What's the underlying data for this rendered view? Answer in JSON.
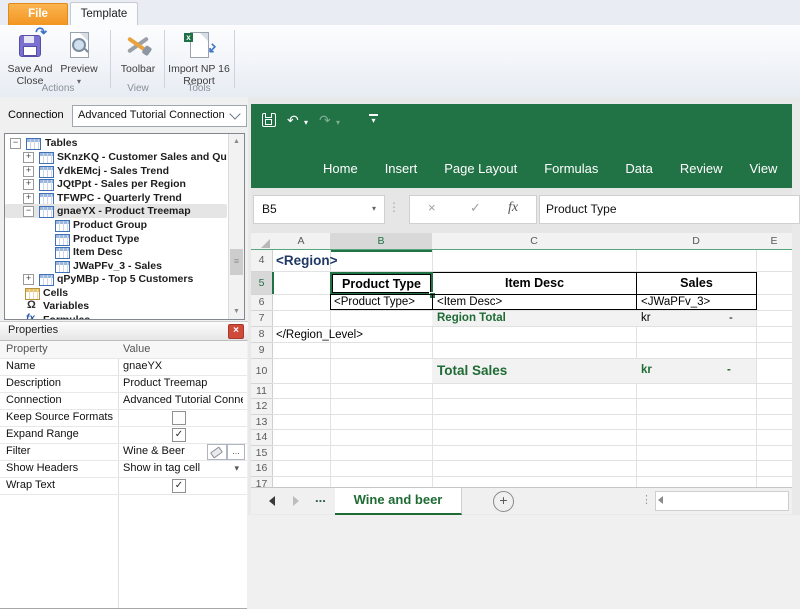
{
  "ribbon": {
    "tabs": [
      {
        "label": "File"
      },
      {
        "label": "Template"
      }
    ],
    "buttons": {
      "save_and_close": "Save And Close",
      "preview": "Preview",
      "toolbar": "Toolbar",
      "import_np": "Import NP 16 Report"
    },
    "groups": [
      {
        "label": "Actions"
      },
      {
        "label": "View"
      },
      {
        "label": "Tools"
      }
    ]
  },
  "connection": {
    "label": "Connection",
    "value": "Advanced Tutorial Connection"
  },
  "tree": {
    "items": [
      {
        "label": "Tables"
      },
      {
        "label": "SKnzKQ - Customer Sales and Quantity"
      },
      {
        "label": "YdkEMcj - Sales Trend"
      },
      {
        "label": "JQtPpt - Sales per Region"
      },
      {
        "label": "TFWPC - Quarterly Trend"
      },
      {
        "label": "gnaeYX - Product Treemap"
      },
      {
        "label": "Product Group"
      },
      {
        "label": "Product Type"
      },
      {
        "label": "Item Desc"
      },
      {
        "label": "JWaPFv_3 - Sales"
      },
      {
        "label": "qPyMBp - Top 5 Customers"
      },
      {
        "label": "Cells"
      },
      {
        "label": "Variables"
      },
      {
        "label": "Formulas"
      }
    ]
  },
  "properties": {
    "title": "Properties",
    "columns": {
      "property": "Property",
      "value": "Value"
    },
    "rows": [
      {
        "property": "Name",
        "value": "gnaeYX"
      },
      {
        "property": "Description",
        "value": "Product Treemap"
      },
      {
        "property": "Connection",
        "value": "Advanced Tutorial Connecti"
      },
      {
        "property": "Keep Source Formats",
        "value": ""
      },
      {
        "property": "Expand Range",
        "value": ""
      },
      {
        "property": "Filter",
        "value": "Wine & Beer"
      },
      {
        "property": "Show Headers",
        "value": "Show in tag cell"
      },
      {
        "property": "Wrap Text",
        "value": ""
      }
    ]
  },
  "excel": {
    "ribbon_tabs": [
      "Home",
      "Insert",
      "Page Layout",
      "Formulas",
      "Data",
      "Review",
      "View"
    ],
    "name_box": "B5",
    "formula_text": "Product Type",
    "columns": [
      "A",
      "B",
      "C",
      "D",
      "E"
    ],
    "row_numbers": [
      "4",
      "5",
      "6",
      "7",
      "8",
      "9",
      "10",
      "11",
      "12",
      "13",
      "14",
      "15",
      "16",
      "17"
    ],
    "cells": {
      "region_open": "<Region>",
      "product_type_header": "Product Type",
      "item_desc_header": "Item Desc",
      "sales_header": "Sales",
      "product_type_tag": "<Product Type>",
      "item_desc_tag": "<Item Desc>",
      "sales_tag": "<JWaPFv_3>",
      "region_total_label": "Region Total",
      "region_total_currency": "kr",
      "region_total_value": "-",
      "region_close": "</Region_Level>",
      "total_sales_label": "Total Sales",
      "total_sales_currency": "kr",
      "total_sales_value": "-"
    },
    "sheet_bar": {
      "more": "...",
      "active_tab": "Wine and beer"
    }
  },
  "icons": {
    "undo": "↶",
    "redo": "↷",
    "dropdown": "▾",
    "cancel": "×",
    "enter": "✓",
    "fx": "fx",
    "dots_vertical": "⋮",
    "omega": "Ω",
    "fx_small": "fx",
    "plus": "+",
    "minus": "−",
    "up_arrow": "▲",
    "down_arrow": "▼",
    "grip": "≡",
    "close": "×",
    "add": "+"
  },
  "colors": {
    "accent_green": "#217346",
    "file_tab_orange": "#f2941f",
    "region_tag_navy": "#1f3864",
    "total_green": "#1e6b34"
  }
}
